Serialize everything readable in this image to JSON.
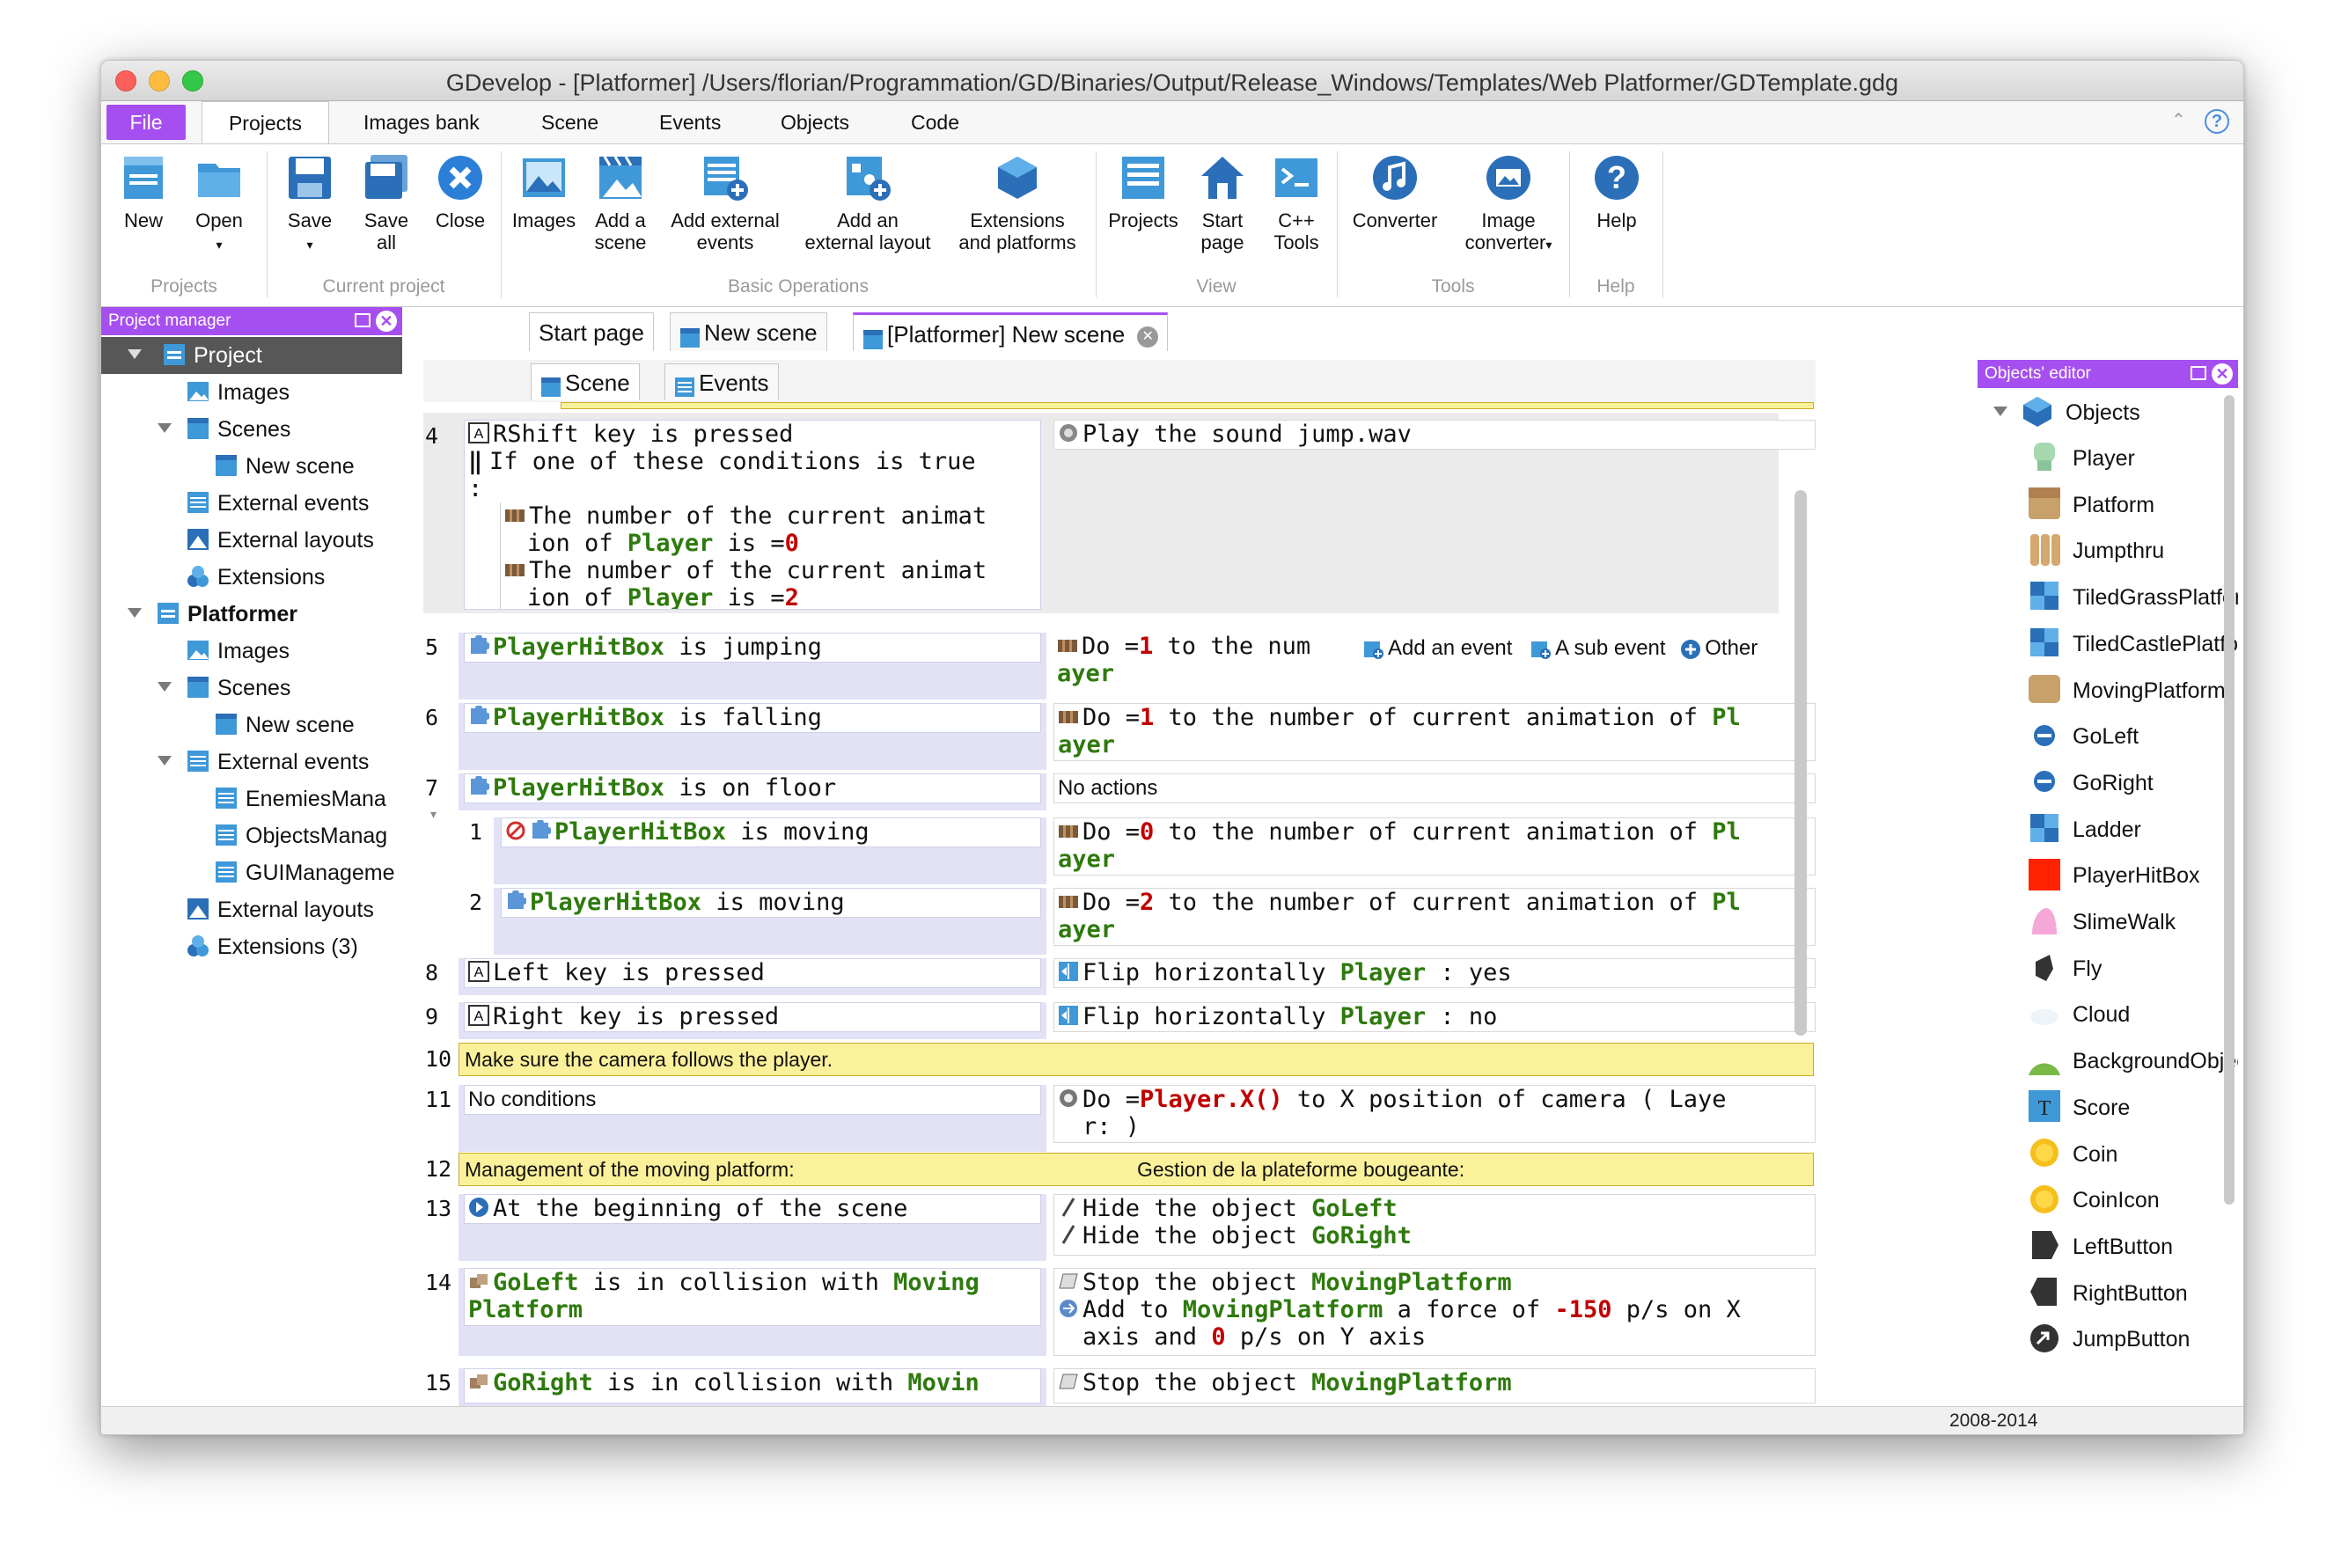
{
  "window": {
    "title": "GDevelop - [Platformer] /Users/florian/Programmation/GD/Binaries/Output/Release_Windows/Templates/Web Platformer/GDTemplate.gdg"
  },
  "menu": {
    "file": "File",
    "tabs": [
      "Projects",
      "Images bank",
      "Scene",
      "Events",
      "Objects",
      "Code"
    ]
  },
  "ribbon": {
    "buttons": {
      "new": "New",
      "open": "Open",
      "save": "Save",
      "save_all_1": "Save",
      "save_all_2": "all",
      "close": "Close",
      "images": "Images",
      "add_scene_1": "Add a",
      "add_scene_2": "scene",
      "add_ext_events_1": "Add external",
      "add_ext_events_2": "events",
      "add_ext_layout_1": "Add an",
      "add_ext_layout_2": "external layout",
      "extensions_1": "Extensions",
      "extensions_2": "and platforms",
      "projects": "Projects",
      "start_page_1": "Start",
      "start_page_2": "page",
      "cpp_tools_1": "C++",
      "cpp_tools_2": "Tools",
      "converter": "Converter",
      "image_converter_1": "Image",
      "image_converter_2": "converter",
      "help": "Help"
    },
    "groups": {
      "projects": "Projects",
      "current_project": "Current project",
      "basic_operations": "Basic Operations",
      "view": "View",
      "tools": "Tools",
      "help": "Help"
    }
  },
  "project_manager": {
    "title": "Project manager",
    "tree": [
      {
        "label": "Project",
        "icon": "project-icon"
      },
      {
        "label": "Images",
        "icon": "images-icon"
      },
      {
        "label": "Scenes",
        "icon": "scenes-icon"
      },
      {
        "label": "New scene",
        "icon": "scene-icon"
      },
      {
        "label": "External events",
        "icon": "external-events-icon"
      },
      {
        "label": "External layouts",
        "icon": "external-layouts-icon"
      },
      {
        "label": "Extensions",
        "icon": "extensions-icon"
      },
      {
        "label": "Platformer",
        "icon": "project-icon"
      },
      {
        "label": "Images",
        "icon": "images-icon"
      },
      {
        "label": "Scenes",
        "icon": "scenes-icon"
      },
      {
        "label": "New scene",
        "icon": "scene-icon"
      },
      {
        "label": "External events",
        "icon": "external-events-icon"
      },
      {
        "label": "EnemiesMana",
        "icon": "external-events-icon"
      },
      {
        "label": "ObjectsManag",
        "icon": "external-events-icon"
      },
      {
        "label": "GUIManageme",
        "icon": "external-events-icon"
      },
      {
        "label": "External layouts",
        "icon": "external-layouts-icon"
      },
      {
        "label": "Extensions (3)",
        "icon": "extensions-icon"
      }
    ]
  },
  "doc_tabs": [
    "Start page",
    "New scene",
    "[Platformer] New scene"
  ],
  "sub_tabs": [
    "Scene",
    "Events"
  ],
  "events": {
    "e4": {
      "num": "4",
      "c1": "RShift key is pressed",
      "c2": "If one of these conditions is true",
      "c3": ":",
      "sub1a": "The number of the current animat",
      "sub1b": "ion of ",
      "player": "Player",
      "sub1c": " is =",
      "v0": "0",
      "v2": "2",
      "a1": "Play the sound jump.wav"
    },
    "e5": {
      "num": "5",
      "obj": "PlayerHitBox",
      "c": " is jumping",
      "a_pre": "Do =",
      "a_val": "1",
      "a_post": " to the num",
      "a_line2": "ayer"
    },
    "toolbar": {
      "add_event": "Add an event",
      "sub_event": "A sub event",
      "other": "Other"
    },
    "e6": {
      "num": "6",
      "obj": "PlayerHitBox",
      "c": " is falling",
      "a_pre": "Do =",
      "a_val": "1",
      "a_post": " to the number of current animation of ",
      "a_pl": "Pl",
      "a_line2": "ayer"
    },
    "e7": {
      "num": "7",
      "obj": "PlayerHitBox",
      "c": " is on floor",
      "a": "No actions"
    },
    "e7_1": {
      "num": "1",
      "obj": "PlayerHitBox",
      "c": " is moving",
      "a_pre": "Do =",
      "a_val": "0",
      "a_post": " to the number of current animation of ",
      "a_pl": "Pl",
      "a_line2": "ayer"
    },
    "e7_2": {
      "num": "2",
      "obj": "PlayerHitBox",
      "c": " is moving",
      "a_pre": "Do =",
      "a_val": "2",
      "a_post": " to the number of current animation of ",
      "a_pl": "Pl",
      "a_line2": "ayer"
    },
    "e8": {
      "num": "8",
      "c": "Left key is pressed",
      "a_pre": "Flip horizontally ",
      "a_obj": "Player",
      "a_post": " : yes"
    },
    "e9": {
      "num": "9",
      "c": "Right key is pressed",
      "a_pre": "Flip horizontally ",
      "a_obj": "Player",
      "a_post": " : no"
    },
    "e10": {
      "num": "10",
      "comment": "Make sure the camera follows the player."
    },
    "e11": {
      "num": "11",
      "c": "No conditions",
      "a_pre": "Do =",
      "a_val": "Player.X()",
      "a_post": " to X position of camera  ( Laye",
      "a_line2": "r:  )"
    },
    "e12": {
      "num": "12",
      "comment1": "Management of the moving platform:",
      "comment2": "Gestion de la plateforme bougeante:"
    },
    "e13": {
      "num": "13",
      "c": "At the beginning of the scene",
      "a1_pre": "Hide the object ",
      "a1_obj": "GoLeft",
      "a2_pre": "Hide the object ",
      "a2_obj": "GoRight"
    },
    "e14": {
      "num": "14",
      "c_obj": "GoLeft",
      "c_mid": " is in collision with ",
      "c_obj2a": "Moving",
      "c_obj2b": "Platform",
      "a1_pre": "Stop the object ",
      "a1_obj": "MovingPlatform",
      "a2_pre": "Add to ",
      "a2_obj": "MovingPlatform",
      "a2_mid": " a force of ",
      "a2_v1": "-150",
      "a2_post": " p/s on X",
      "a2_l2_pre": "axis and ",
      "a2_v2": "0",
      "a2_l2_post": " p/s on Y axis"
    },
    "e15": {
      "num": "15",
      "c_obj": "GoRight",
      "c_mid": " is in collision with ",
      "c_obj2": "Movin",
      "a_pre": "Stop the object ",
      "a_obj": "MovingPlatform"
    }
  },
  "objects_editor": {
    "title": "Objects' editor",
    "root": "Objects",
    "items": [
      "Player",
      "Platform",
      "Jumpthru",
      "TiledGrassPlatform",
      "TiledCastlePlatform",
      "MovingPlatform",
      "GoLeft",
      "GoRight",
      "Ladder",
      "PlayerHitBox",
      "SlimeWalk",
      "Fly",
      "Cloud",
      "BackgroundObjects",
      "Score",
      "Coin",
      "CoinIcon",
      "LeftButton",
      "RightButton",
      "JumpButton"
    ]
  },
  "status": {
    "years": "2008-2014"
  },
  "colors": {
    "accent": "#a64ff0",
    "comment_bg": "#fbf19a",
    "object_name": "#2e7a0d",
    "value": "#c00000"
  }
}
